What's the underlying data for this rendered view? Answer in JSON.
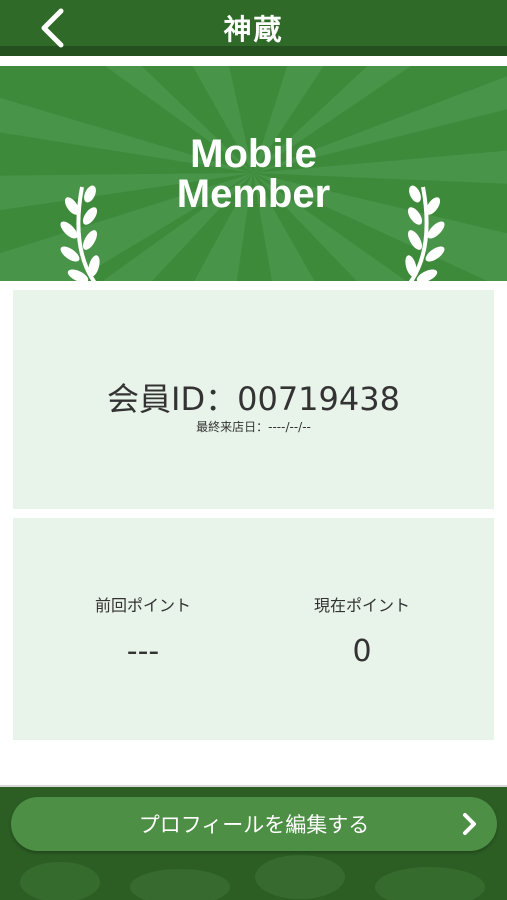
{
  "header": {
    "logo_text": "神蔵",
    "back_icon": "chevron-left-icon"
  },
  "banner": {
    "title_line1": "Mobile",
    "title_line2": "Member",
    "decoration_icon": "laurel-branch-icon"
  },
  "member_card": {
    "member_id": "会員ID：00719438",
    "last_visit": "最終来店日：----/--/--"
  },
  "points": {
    "previous_label": "前回ポイント",
    "previous_value": "---",
    "current_label": "現在ポイント",
    "current_value": "0"
  },
  "footer": {
    "profile_button_label": "プロフィールを編集する",
    "arrow_icon": "chevron-right-icon"
  },
  "colors": {
    "header_green": "#2f6a28",
    "banner_green": "#3d8a3b",
    "card_bg": "#e8f3ea",
    "button_green": "#4c8f45"
  }
}
